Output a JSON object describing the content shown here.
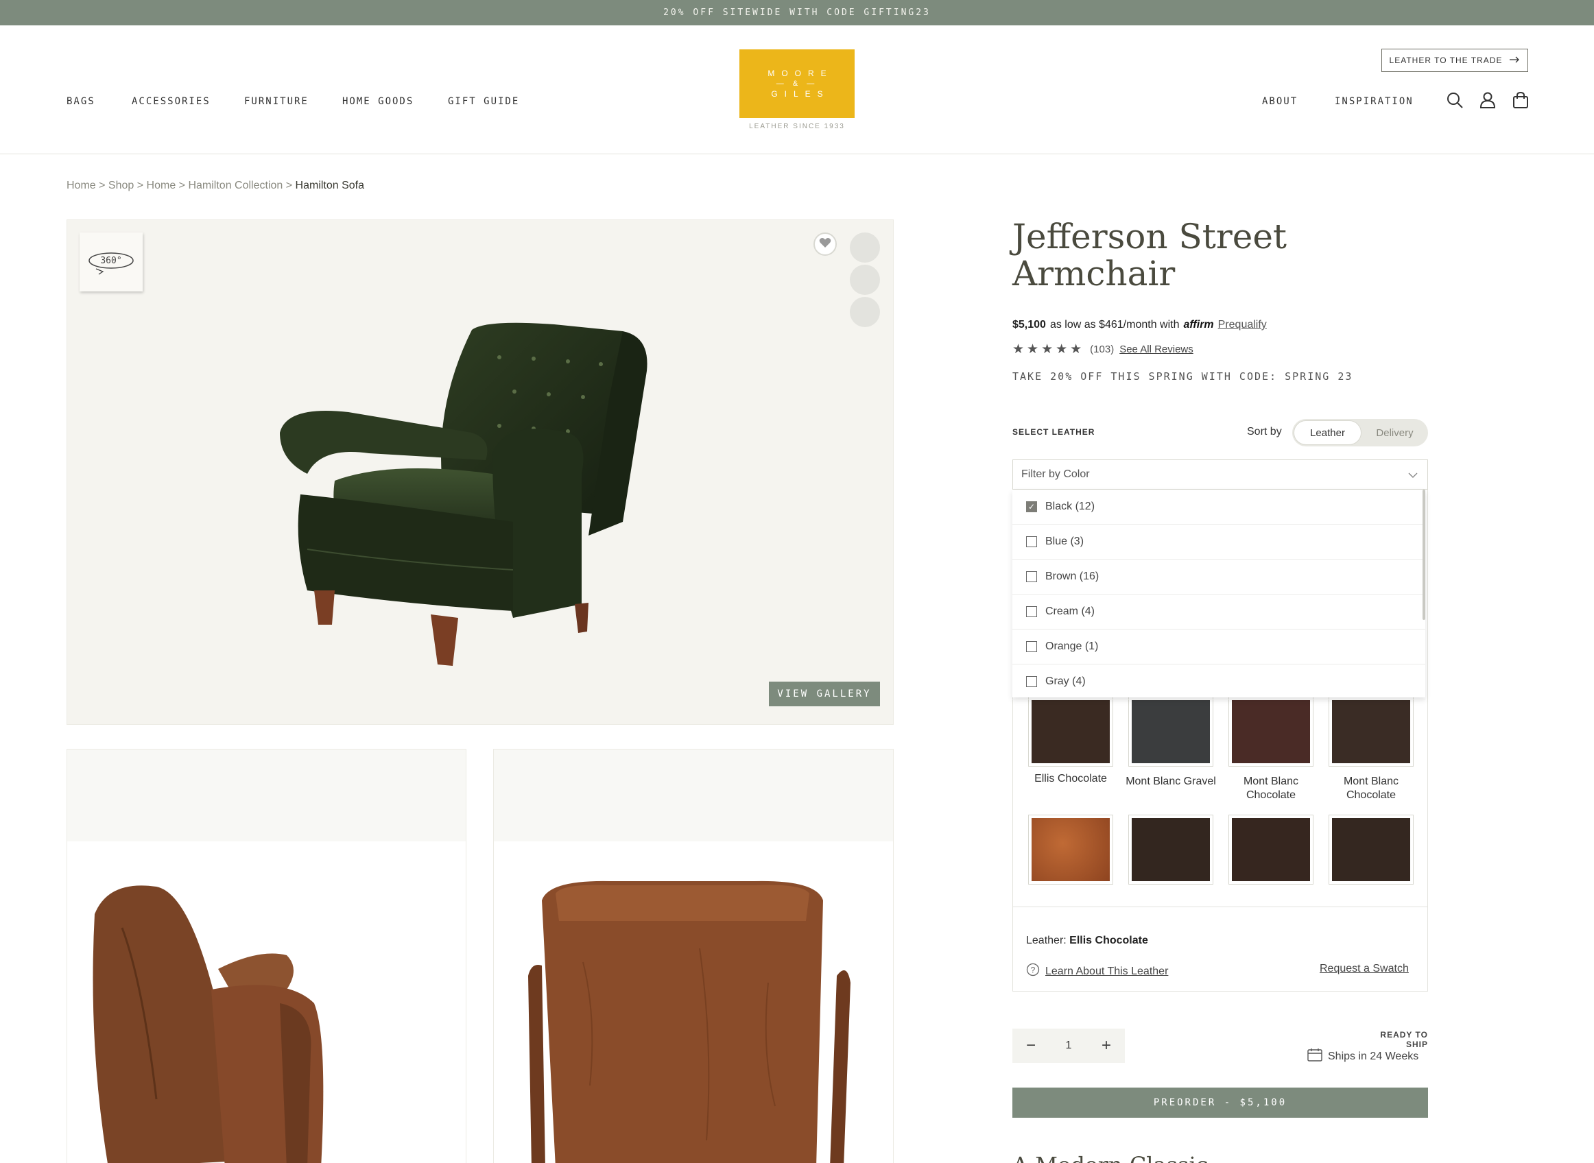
{
  "promo": {
    "text": "20% OFF SITEWIDE WITH CODE GIFTING23"
  },
  "nav": {
    "left": [
      "BAGS",
      "ACCESSORIES",
      "FURNITURE",
      "HOME GOODS",
      "GIFT GUIDE"
    ],
    "right": [
      "ABOUT",
      "INSPIRATION"
    ],
    "trade_button": "LEATHER TO THE TRADE",
    "icons": [
      "search-icon",
      "account-icon",
      "cart-icon"
    ]
  },
  "logo": {
    "line1": "MOORE",
    "line2": "— & —",
    "line3": "GILES",
    "tagline": "LEATHER SINCE 1933",
    "color": "#ecb61a"
  },
  "breadcrumb": [
    "Home",
    "Shop",
    "Home",
    "Hamilton Collection"
  ],
  "breadcrumb_current": "Hamilton Sofa",
  "gallery": {
    "badge": "360°",
    "view_gallery": "VIEW GALLERY"
  },
  "product": {
    "title_line1": "Jefferson Street",
    "title_line2": "Armchair",
    "price": "$5,100",
    "financing": "as low as $461/month with",
    "affirm": "affirm",
    "prequalify": "Prequalify",
    "stars": "★★★★★",
    "review_count": "(103)",
    "see_reviews": "See All Reviews",
    "promo_code": "TAKE 20% OFF THIS SPRING WITH CODE: SPRING 23"
  },
  "leather": {
    "select_label": "SELECT LEATHER",
    "sort_label": "Sort by",
    "sort_options": [
      "Leather",
      "Delivery"
    ],
    "filter_placeholder": "Filter by Color",
    "filter_options": [
      {
        "label": "Black (12)",
        "checked": true
      },
      {
        "label": "Blue (3)",
        "checked": false
      },
      {
        "label": "Brown (16)",
        "checked": false
      },
      {
        "label": "Cream (4)",
        "checked": false
      },
      {
        "label": "Orange (1)",
        "checked": false
      },
      {
        "label": "Gray (4)",
        "checked": false
      }
    ],
    "swatches": [
      {
        "name": "Ellis Chocolate",
        "color": "#3a2a22"
      },
      {
        "name": "Mont Blanc Gravel",
        "color": "#3b3d3e"
      },
      {
        "name": "Mont Blanc Chocolate",
        "color": "#4a2b26"
      },
      {
        "name": "Mont Blanc Chocolate",
        "color": "#3a2c25"
      },
      {
        "name": "",
        "color": "#a85a2c"
      },
      {
        "name": "",
        "color": "#33261f"
      },
      {
        "name": "",
        "color": "#36261f"
      },
      {
        "name": "",
        "color": "#342720"
      }
    ],
    "selected_label": "Leather:",
    "selected_value": "Ellis Chocolate",
    "learn_link": "Learn About This Leather",
    "swatch_link": "Request a Swatch"
  },
  "purchase": {
    "qty": "1",
    "ready": "READY TO SHIP",
    "ships": "Ships in 24 Weeks",
    "preorder": "PREORDER - $5,100"
  },
  "next_section": {
    "heading": "A Modern Classic"
  },
  "colors": {
    "accent": "#7d8b7d",
    "logo": "#ecb61a"
  }
}
